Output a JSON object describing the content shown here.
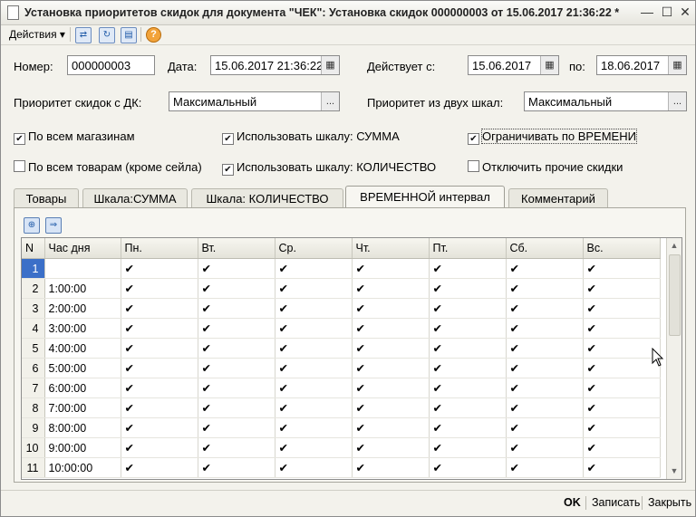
{
  "window": {
    "title": "Установка приоритетов скидок для документа \"ЧЕК\": Установка скидок 000000003 от 15.06.2017 21:36:22 *",
    "controls": [
      "—",
      "☐",
      "✕"
    ]
  },
  "toolbar": {
    "actions_label": "Действия",
    "help": "?"
  },
  "form": {
    "number_label": "Номер:",
    "number_value": "000000003",
    "date_label": "Дата:",
    "date_value": "15.06.2017 21:36:22",
    "valid_from_label": "Действует с:",
    "valid_from_value": "15.06.2017",
    "valid_to_label": "по:",
    "valid_to_value": "18.06.2017",
    "dk_priority_label": "Приоритет скидок с ДК:",
    "dk_priority_value": "Максимальный",
    "two_scales_label": "Приоритет из двух шкал:",
    "two_scales_value": "Максимальный",
    "ellipsis": "..."
  },
  "checkboxes": [
    {
      "label": "По всем магазинам",
      "checked": true
    },
    {
      "label": "Использовать шкалу: СУММА",
      "checked": true
    },
    {
      "label": "Ограничивать по ВРЕМЕНИ",
      "checked": true
    },
    {
      "label": "По всем товарам (кроме сейла)",
      "checked": false
    },
    {
      "label": "Использовать шкалу: КОЛИЧЕСТВО",
      "checked": true
    },
    {
      "label": "Отключить прочие скидки",
      "checked": false
    }
  ],
  "tabs": [
    "Товары",
    "Шкала:СУММА",
    "Шкала: КОЛИЧЕСТВО",
    "ВРЕМЕННОЙ интервал",
    "Комментарий"
  ],
  "active_tab": "ВРЕМЕННОЙ интервал",
  "table": {
    "columns": [
      "N",
      "Час дня",
      "Пн.",
      "Вт.",
      "Ср.",
      "Чт.",
      "Пт.",
      "Сб.",
      "Вс."
    ],
    "rows": [
      {
        "n": "1",
        "hour": ""
      },
      {
        "n": "2",
        "hour": "1:00:00"
      },
      {
        "n": "3",
        "hour": "2:00:00"
      },
      {
        "n": "4",
        "hour": "3:00:00"
      },
      {
        "n": "5",
        "hour": "4:00:00"
      },
      {
        "n": "6",
        "hour": "5:00:00"
      },
      {
        "n": "7",
        "hour": "6:00:00"
      },
      {
        "n": "8",
        "hour": "7:00:00"
      },
      {
        "n": "9",
        "hour": "8:00:00"
      },
      {
        "n": "10",
        "hour": "9:00:00"
      },
      {
        "n": "11",
        "hour": "10:00:00"
      }
    ],
    "selected_row": "1",
    "check_glyph": "✔"
  },
  "footer": {
    "ok": "OK",
    "save": "Записать",
    "close": "Закрыть"
  },
  "colors": {
    "selection": "#3b6fc8",
    "background": "#f3f2ec"
  },
  "icons": [
    "doc-icon",
    "minimize-icon",
    "maximize-icon",
    "close-icon",
    "add-row-icon",
    "move-row-icon",
    "refresh-icon",
    "copy-icon",
    "help-icon",
    "calendar-icon",
    "mouse-cursor-icon"
  ]
}
